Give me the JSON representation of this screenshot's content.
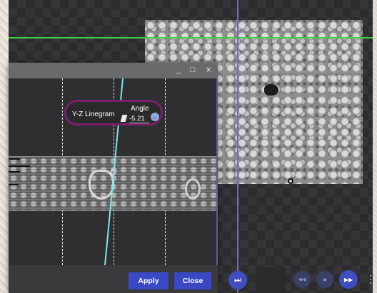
{
  "linegram_dialog": {
    "panel_label": "Y-Z Linegram",
    "angle_label": "Angle",
    "angle_value": "-5.21",
    "apply_label": "Apply",
    "close_label": "Close"
  },
  "window_controls": {
    "minimize": "_",
    "maximize": "□",
    "close": "×"
  },
  "playback": {
    "play_next_glyph": "⏭",
    "rewind_glyph": "◀◀",
    "stop_glyph": "■",
    "fast_forward_glyph": "▶▶",
    "more_glyph": "⋮"
  },
  "colors": {
    "horizontal_line": "#3fd23f",
    "vertical_line": "#7a5cf0",
    "linegram_line": "#7fe3f0",
    "button_blue": "#3a48c4",
    "panel_border": "#7b1f6e"
  },
  "icons": [
    "minimize-icon",
    "maximize-icon",
    "close-icon",
    "edit-icon",
    "arrow-left-icon",
    "skip-next-icon",
    "rewind-icon",
    "stop-icon",
    "fast-forward-icon",
    "more-vert-icon"
  ]
}
